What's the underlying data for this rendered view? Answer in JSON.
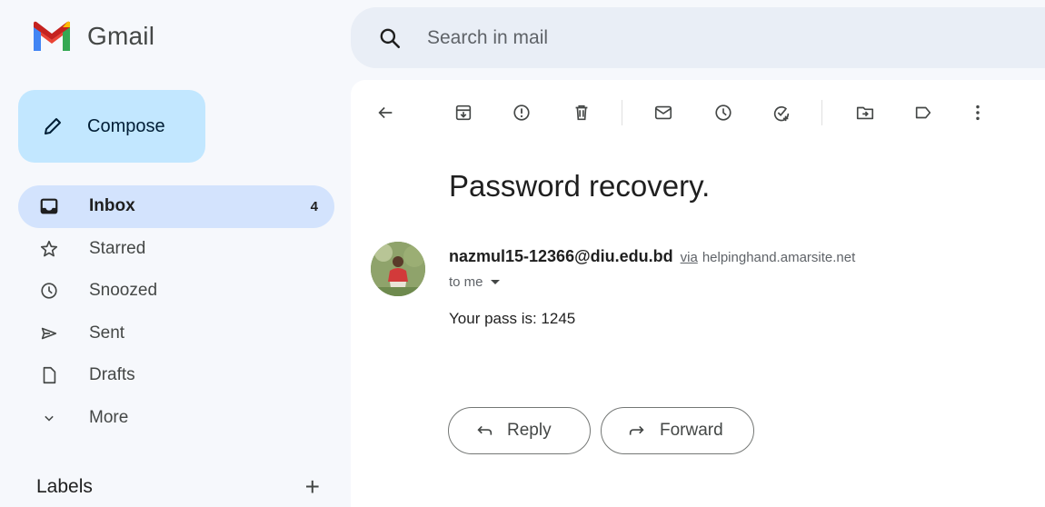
{
  "app": {
    "name": "Gmail"
  },
  "compose": {
    "label": "Compose"
  },
  "nav": {
    "items": [
      {
        "label": "Inbox",
        "count": "4",
        "icon": "inbox-icon"
      },
      {
        "label": "Starred",
        "icon": "star-icon"
      },
      {
        "label": "Snoozed",
        "icon": "clock-icon"
      },
      {
        "label": "Sent",
        "icon": "send-icon"
      },
      {
        "label": "Drafts",
        "icon": "draft-icon"
      },
      {
        "label": "More",
        "icon": "chevron-down-icon"
      }
    ]
  },
  "labels": {
    "title": "Labels",
    "add": "+"
  },
  "search": {
    "placeholder": "Search in mail"
  },
  "email": {
    "subject": "Password recovery.",
    "sender": "nazmul15-12366@diu.edu.bd",
    "via": "via",
    "via_domain": "helpinghand.amarsite.net",
    "recipient": "to me",
    "body": "Your pass is: 1245"
  },
  "actions": {
    "reply": "Reply",
    "forward": "Forward"
  },
  "colors": {
    "accent": "#c2e7ff",
    "active_nav": "#d3e3fd",
    "background": "#f6f8fc",
    "search_bg": "#e9eef6"
  }
}
